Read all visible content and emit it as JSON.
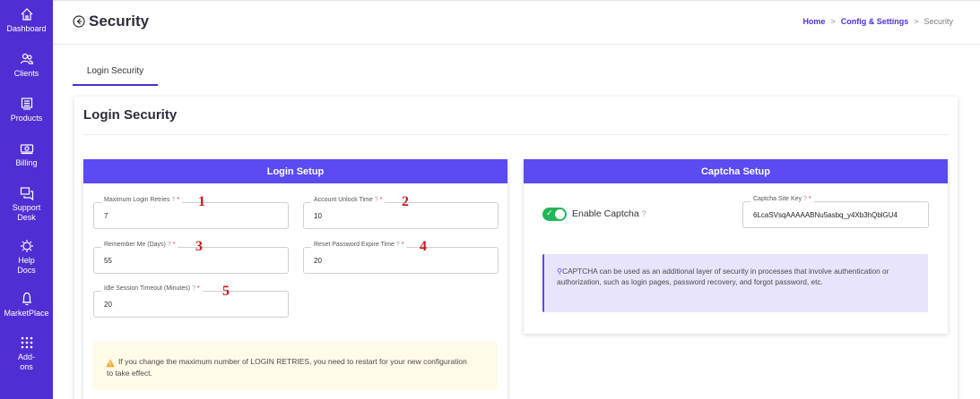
{
  "sidebar": {
    "items": [
      {
        "label": "Dashboard",
        "icon": "home-icon"
      },
      {
        "label": "Clients",
        "icon": "users-icon"
      },
      {
        "label": "Products",
        "icon": "box-icon"
      },
      {
        "label": "Billing",
        "icon": "money-icon"
      },
      {
        "label": "Support Desk",
        "icon": "chat-icon"
      },
      {
        "label": "Help Docs",
        "icon": "help-icon"
      },
      {
        "label": "MarketPlace",
        "icon": "marketplace-icon"
      },
      {
        "label": "Add-ons",
        "icon": "grid-icon"
      }
    ]
  },
  "header": {
    "title": "Security",
    "breadcrumb": {
      "home": "Home",
      "sep1": ">",
      "config": "Config & Settings",
      "sep2": ">",
      "current": "Security"
    }
  },
  "tabs": [
    {
      "label": "Login Security",
      "active": true
    }
  ],
  "card": {
    "title": "Login Security",
    "login_setup": {
      "heading": "Login Setup",
      "fields": [
        {
          "label": "Maximum Login Retries",
          "value": "7",
          "callout": "1"
        },
        {
          "label": "Account Unlock Time",
          "value": "10",
          "callout": "2"
        },
        {
          "label": "Remember Me (Days)",
          "value": "55",
          "callout": "3"
        },
        {
          "label": "Reset Password Expire Time",
          "value": "20",
          "callout": "4"
        },
        {
          "label": "Idle Session Timeout (Minutes)",
          "value": "20",
          "callout": "5"
        }
      ],
      "required_mark": "*",
      "help_mark": "?",
      "warning": "If you change the maximum number of LOGIN RETRIES, you need to restart for your new configuration to take effect."
    },
    "captcha_setup": {
      "heading": "Captcha Setup",
      "toggle_label": "Enable Captcha",
      "toggle_on": true,
      "site_key_label": "Captcha Site Key",
      "site_key_value": "6LcaSVsqAAAAABNu5asbq_y4Xb3hQblGU4",
      "info": "CAPTCHA can be used as an additional layer of security in processes that involve authentication or authorization, such as login pages, password recovery, and forgot password, etc."
    }
  },
  "colors": {
    "sidebar": "#4f2fd3",
    "panel_header": "#5b4bf2",
    "toggle_on": "#22b55a",
    "callout": "#c8181e",
    "warning_bg": "#fffbe8",
    "info_bg": "#e7e4fb"
  }
}
